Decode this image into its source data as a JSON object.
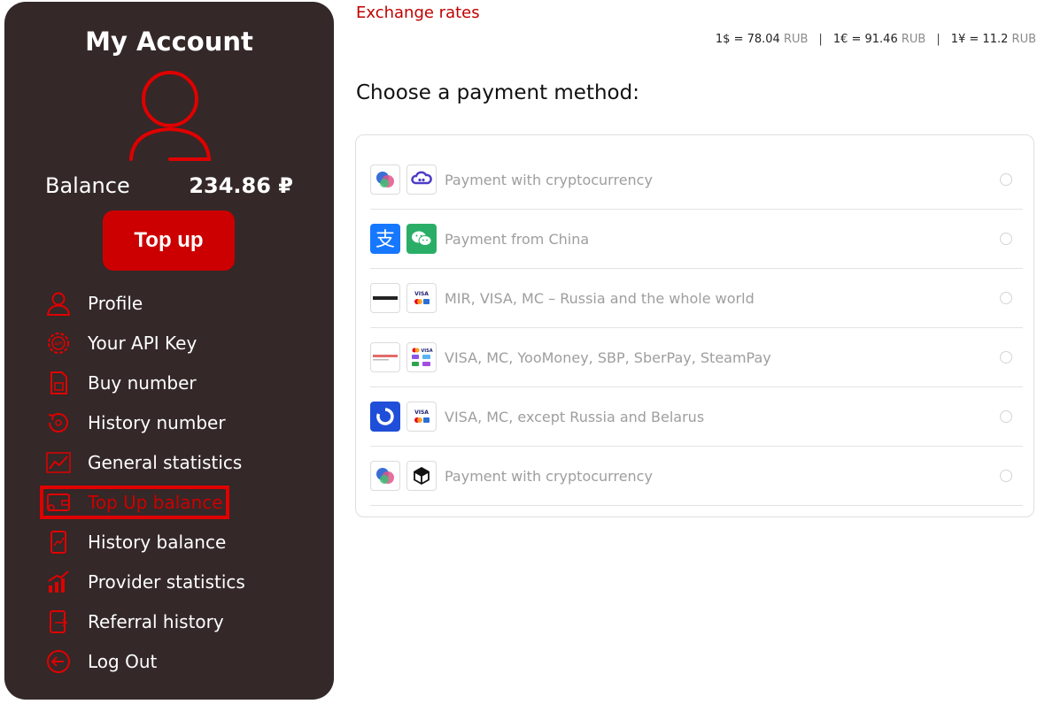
{
  "sidebar": {
    "title": "My Account",
    "balance_label": "Balance",
    "balance_value": "234.86 ₽",
    "topup_label": "Top up",
    "menu": [
      {
        "label": "Profile",
        "icon": "user-icon"
      },
      {
        "label": "Your API Key",
        "icon": "api-gear-icon"
      },
      {
        "label": "Buy number",
        "icon": "sim-card-icon"
      },
      {
        "label": "History number",
        "icon": "history-icon"
      },
      {
        "label": "General statistics",
        "icon": "line-chart-icon"
      },
      {
        "label": "Top Up balance",
        "icon": "wallet-icon",
        "active": true
      },
      {
        "label": "History balance",
        "icon": "phone-chart-icon"
      },
      {
        "label": "Provider statistics",
        "icon": "bar-chart-icon"
      },
      {
        "label": "Referral history",
        "icon": "phone-share-icon"
      },
      {
        "label": "Log Out",
        "icon": "logout-icon"
      }
    ]
  },
  "rates": {
    "title": "Exchange rates",
    "items": [
      {
        "value": "1$ = 78.04",
        "unit": "RUB"
      },
      {
        "value": "1€ = 91.46",
        "unit": "RUB"
      },
      {
        "value": "1¥ = 11.2",
        "unit": "RUB"
      }
    ],
    "separator": "|"
  },
  "payment": {
    "heading": "Choose a payment method:",
    "methods": [
      {
        "label": "Payment with cryptocurrency",
        "logos": [
          "crypto-coins-icon",
          "cryptocloud-icon"
        ]
      },
      {
        "label": "Payment from China",
        "logos": [
          "alipay-icon",
          "wechat-pay-icon"
        ]
      },
      {
        "label": "MIR, VISA, MC – Russia and the whole world",
        "logos": [
          "monume-logo",
          "visa-mc-icon"
        ]
      },
      {
        "label": "VISA, MC, YooMoney, SBP, SberPay, SteamPay",
        "logos": [
          "freekassa-logo",
          "multi-pay-icon"
        ]
      },
      {
        "label": "VISA, MC, except Russia and Belarus",
        "logos": [
          "blue-circle-logo",
          "visa-mc-icon"
        ]
      },
      {
        "label": "Payment with cryptocurrency",
        "logos": [
          "crypto-coins-icon",
          "cube-icon"
        ]
      }
    ]
  },
  "colors": {
    "sidebar_bg": "#342828",
    "accent": "#cc0000"
  }
}
